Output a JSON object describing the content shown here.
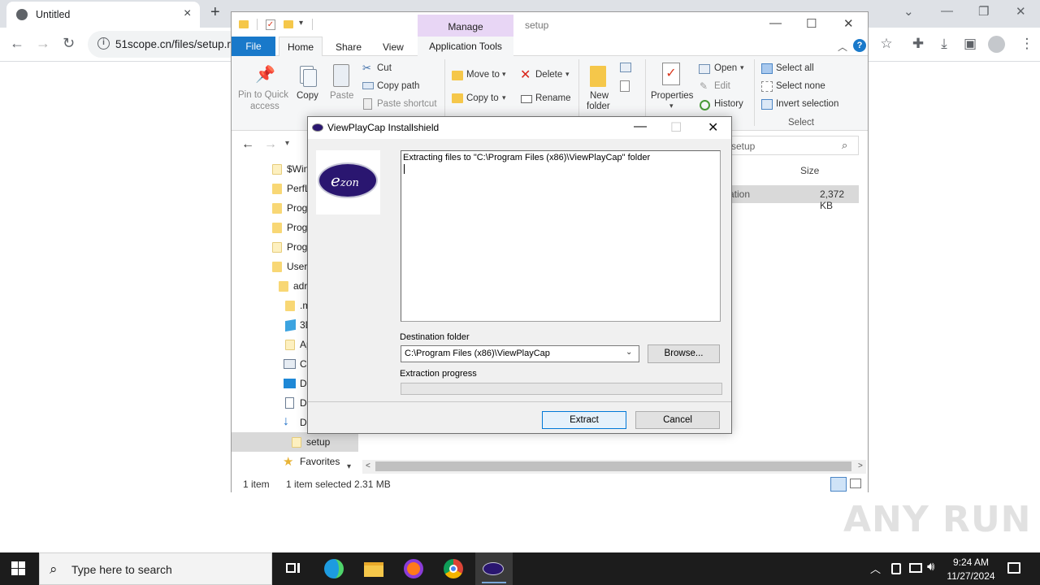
{
  "browser": {
    "tab_title": "Untitled",
    "url": "51scope.cn/files/setup.r",
    "new_tab_symbol": "+"
  },
  "explorer": {
    "title": "setup",
    "contextual_tab_group": "Manage",
    "ribbon_tabs": {
      "file": "File",
      "home": "Home",
      "share": "Share",
      "view": "View",
      "application_tools": "Application Tools"
    },
    "clipboard": {
      "pin_line1": "Pin to Quick",
      "pin_line2": "access",
      "copy": "Copy",
      "paste": "Paste",
      "cut": "Cut",
      "copy_path": "Copy path",
      "paste_shortcut": "Paste shortcut"
    },
    "organize": {
      "move_to": "Move to",
      "copy_to": "Copy to",
      "delete": "Delete",
      "rename": "Rename"
    },
    "new": {
      "new_folder_line1": "New",
      "new_folder_line2": "folder"
    },
    "open_group": {
      "properties": "Properties",
      "open": "Open",
      "edit": "Edit",
      "history": "History"
    },
    "select_group": {
      "select_all": "Select all",
      "select_none": "Select none",
      "invert_selection": "Invert selection",
      "group_label": "Select"
    },
    "search_text": "setup",
    "column_size": "Size",
    "selected_row": {
      "type_tail": "ation",
      "size": "2,372 KB"
    },
    "tree": [
      {
        "label": "$Win"
      },
      {
        "label": "PerfL"
      },
      {
        "label": "Prog"
      },
      {
        "label": "Prog"
      },
      {
        "label": "Prog"
      },
      {
        "label": "Users"
      },
      {
        "label": "adr"
      },
      {
        "label": ".m"
      },
      {
        "label": "3D"
      },
      {
        "label": "Ap"
      },
      {
        "label": "Co"
      },
      {
        "label": "De"
      },
      {
        "label": "Do"
      },
      {
        "label": "Do"
      },
      {
        "label": "setup"
      },
      {
        "label": "Favorites"
      }
    ],
    "status": {
      "item_count": "1 item",
      "selection": "1 item selected  2.31 MB"
    }
  },
  "dialog": {
    "title": "ViewPlayCap Installshield",
    "logo_text_e": "e",
    "logo_text_rest": "zon",
    "log_line": "Extracting files to \"C:\\Program Files (x86)\\ViewPlayCap\" folder",
    "destination_label": "Destination folder",
    "destination_value": "C:\\Program Files (x86)\\ViewPlayCap",
    "browse_button": "Browse...",
    "progress_label": "Extraction progress",
    "progress_fraction": 0,
    "extract_button": "Extract",
    "cancel_button": "Cancel"
  },
  "watermark": "ANY RUN",
  "taskbar": {
    "search_placeholder": "Type here to search",
    "time": "9:24 AM",
    "date": "11/27/2024"
  },
  "colors": {
    "accent_blue": "#1979ca",
    "manage_tab": "#e8d6f5",
    "logo_purple": "#2a1670",
    "taskbar": "#1c1c1c"
  }
}
